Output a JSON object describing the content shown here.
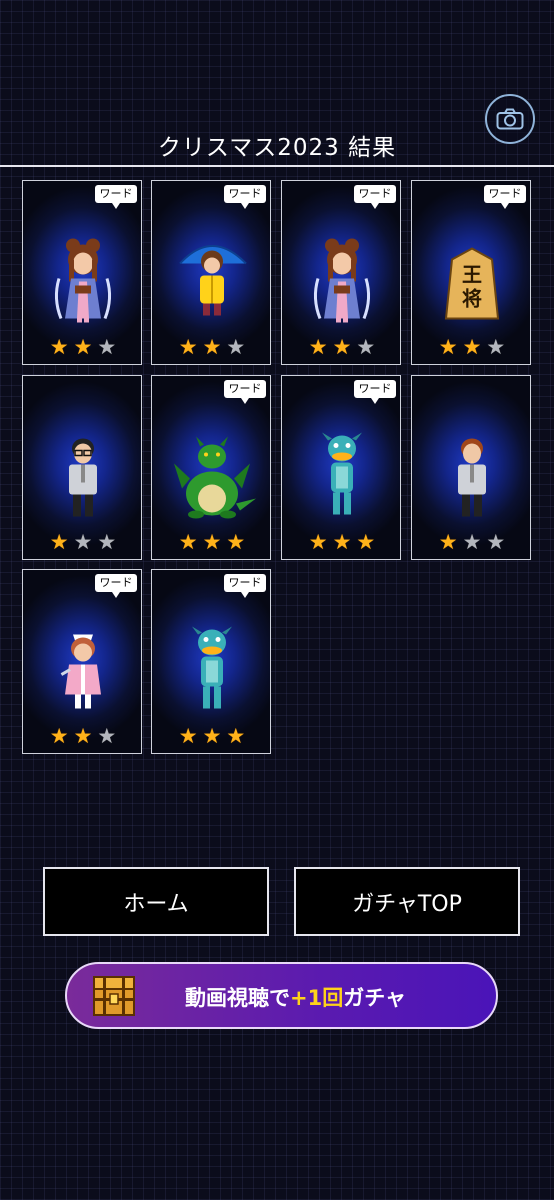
{
  "header": {
    "title": "クリスマス2023 結果"
  },
  "cards": [
    {
      "character": "princess",
      "word_badge": "ワード",
      "stars": 2
    },
    {
      "character": "umbrella-child",
      "word_badge": "ワード",
      "stars": 2
    },
    {
      "character": "princess",
      "word_badge": "ワード",
      "stars": 2
    },
    {
      "character": "shogi-king-piece",
      "word_badge": "ワード",
      "stars": 2
    },
    {
      "character": "man-glasses",
      "word_badge": "",
      "stars": 1
    },
    {
      "character": "green-dragon",
      "word_badge": "ワード",
      "stars": 3
    },
    {
      "character": "fish-man",
      "word_badge": "ワード",
      "stars": 3
    },
    {
      "character": "man-brown-hair",
      "word_badge": "",
      "stars": 1
    },
    {
      "character": "nurse",
      "word_badge": "ワード",
      "stars": 2
    },
    {
      "character": "fish-man",
      "word_badge": "ワード",
      "stars": 3
    }
  ],
  "shogi_piece_text": [
    "王",
    "将"
  ],
  "buttons": {
    "home": "ホーム",
    "gacha_top": "ガチャTOP"
  },
  "video_gacha": {
    "part1": "動画視聴で",
    "part2": "+1回",
    "part3": "ガチャ"
  },
  "colors": {
    "star_on": "#ffb21a",
    "star_off": "#b3b6bd",
    "gacha_purple": "#5a1ab0",
    "highlight": "#ffd21a"
  }
}
